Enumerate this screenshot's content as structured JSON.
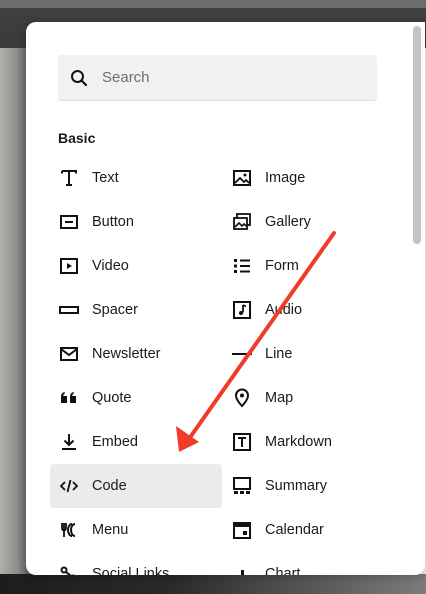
{
  "search": {
    "placeholder": "Search",
    "value": ""
  },
  "section": {
    "title": "Basic"
  },
  "items_left": [
    {
      "label": "Text",
      "icon": "text-icon"
    },
    {
      "label": "Button",
      "icon": "button-icon"
    },
    {
      "label": "Video",
      "icon": "video-icon"
    },
    {
      "label": "Spacer",
      "icon": "spacer-icon"
    },
    {
      "label": "Newsletter",
      "icon": "newsletter-icon"
    },
    {
      "label": "Quote",
      "icon": "quote-icon"
    },
    {
      "label": "Embed",
      "icon": "embed-icon"
    },
    {
      "label": "Code",
      "icon": "code-icon",
      "selected": true
    },
    {
      "label": "Menu",
      "icon": "menu-icon"
    },
    {
      "label": "Social Links",
      "icon": "social-links-icon"
    }
  ],
  "items_right": [
    {
      "label": "Image",
      "icon": "image-icon"
    },
    {
      "label": "Gallery",
      "icon": "gallery-icon"
    },
    {
      "label": "Form",
      "icon": "form-icon"
    },
    {
      "label": "Audio",
      "icon": "audio-icon"
    },
    {
      "label": "Line",
      "icon": "line-icon"
    },
    {
      "label": "Map",
      "icon": "map-icon"
    },
    {
      "label": "Markdown",
      "icon": "markdown-icon"
    },
    {
      "label": "Summary",
      "icon": "summary-icon"
    },
    {
      "label": "Calendar",
      "icon": "calendar-icon"
    },
    {
      "label": "Chart",
      "icon": "chart-icon"
    }
  ],
  "colors": {
    "accent_arrow": "#f03a2a",
    "selected_bg": "#ebebeb"
  }
}
